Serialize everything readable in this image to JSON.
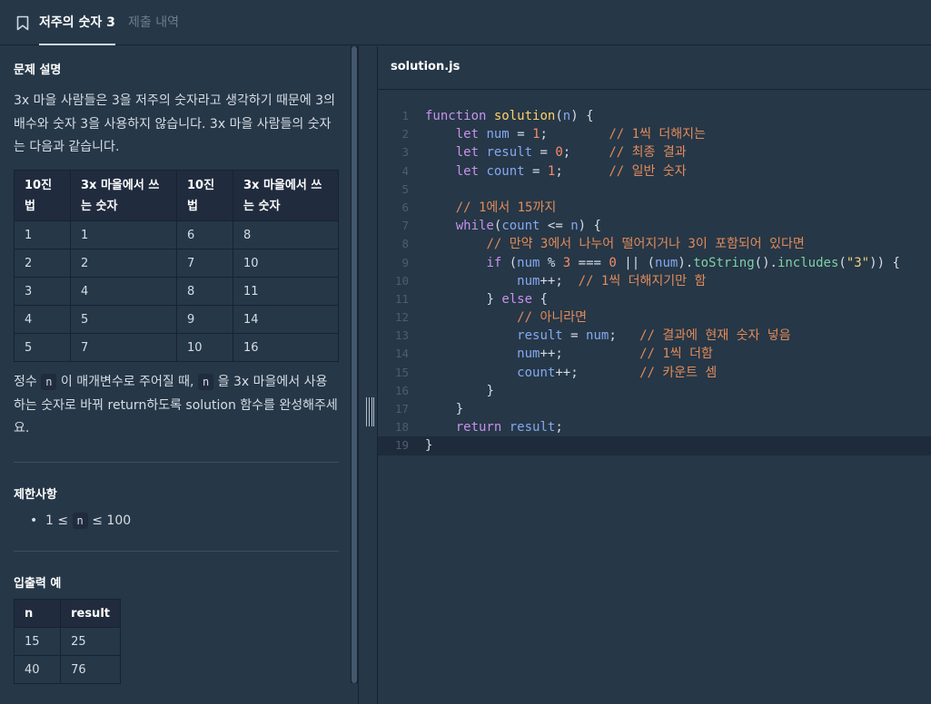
{
  "tabs": {
    "problem_title": "저주의 숫자 3",
    "submissions": "제출 내역"
  },
  "problem": {
    "section_description": "문제 설명",
    "intro_lines": [
      "3x 마을 사람들은 3을 저주의 숫자라고 생각하기 때문에 3의",
      "배수와 숫자 3을 사용하지 않습니다. 3x 마을 사람들의 숫자",
      "는 다음과 같습니다."
    ],
    "number_table": {
      "headers": [
        "10진\n법",
        "3x 마을에서 쓰\n는 숫자",
        "10진\n법",
        "3x 마을에서 쓰\n는 숫자"
      ],
      "header_lines": [
        [
          "10진",
          "법"
        ],
        [
          "3x 마을에서 쓰",
          "는 숫자"
        ],
        [
          "10진",
          "법"
        ],
        [
          "3x 마을에서 쓰",
          "는 숫자"
        ]
      ],
      "rows": [
        [
          "1",
          "1",
          "6",
          "8"
        ],
        [
          "2",
          "2",
          "7",
          "10"
        ],
        [
          "3",
          "4",
          "8",
          "11"
        ],
        [
          "4",
          "5",
          "9",
          "14"
        ],
        [
          "5",
          "7",
          "10",
          "16"
        ]
      ]
    },
    "task_line1_a": "정수 ",
    "task_code_n": "n",
    "task_line1_b": " 이 매개변수로 주어질 때, ",
    "task_line1_c": " 을 3x 마을에서 사용",
    "task_line2": "하는 숫자로 바꿔 return하도록 solution 함수를 완성해주세",
    "task_line3": "요.",
    "section_constraints": "제한사항",
    "constraint_prefix": "1 ≤ ",
    "constraint_code": "n",
    "constraint_suffix": " ≤ 100",
    "section_examples": "입출력 예",
    "example_table": {
      "headers": [
        "n",
        "result"
      ],
      "rows": [
        [
          "15",
          "25"
        ],
        [
          "40",
          "76"
        ]
      ]
    }
  },
  "editor": {
    "filename": "solution.js",
    "current_line": 19,
    "lines": [
      "function solution(n) {",
      "    let num = 1;        // 1씩 더해지는",
      "    let result = 0;     // 최종 결과",
      "    let count = 1;      // 일반 숫자",
      "",
      "    // 1에서 15까지",
      "    while(count <= n) {",
      "        // 만약 3에서 나누어 떨어지거나 3이 포함되어 있다면",
      "        if (num % 3 === 0 || (num).toString().includes(\"3\")) {",
      "            num++;  // 1씩 더해지기만 함",
      "        } else {",
      "            // 아니라면",
      "            result = num;   // 결과에 현재 숫자 넣음",
      "            num++;          // 1씩 더함",
      "            count++;        // 카운트 셈",
      "        }",
      "    }",
      "    return result;",
      "}"
    ]
  },
  "icons": {
    "bookmark": "bookmark-icon",
    "resize_handle": "resize-handle-icon"
  },
  "colors": {
    "background": "#263747",
    "dark": "#172334",
    "keyword": "#c792ea",
    "function": "#ffd166",
    "method": "#7fd1a3",
    "number": "#f78c6c",
    "comment": "#e28b5a"
  }
}
